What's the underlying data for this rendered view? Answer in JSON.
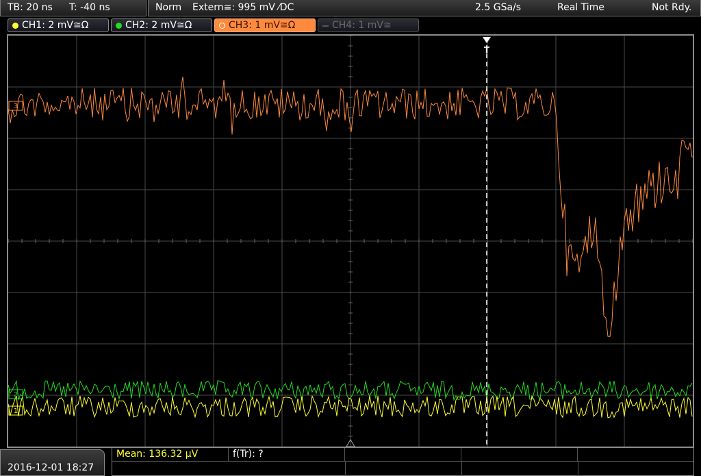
{
  "status_bar": {
    "timebase": "TB: 20 ns",
    "trigger_time": "T: -40 ns",
    "trigger_mode": "Norm",
    "trigger_source": "Extern≅: 995 mV ⁄DC",
    "sample_rate": "2.5 GSa/s",
    "acq_mode": "Real Time",
    "acq_status": "Not Rdy."
  },
  "channels": [
    {
      "label": "CH1: 2 mV≅Ω",
      "color": "#ffff33",
      "active": false,
      "enabled": true
    },
    {
      "label": "CH2: 2 mV≅Ω",
      "color": "#22dd22",
      "active": false,
      "enabled": true
    },
    {
      "label": "CH3: 1 mV≅Ω",
      "color": "#ff8a3d",
      "active": true,
      "enabled": true
    },
    {
      "label": "CH4: 1 mV≅",
      "color": "#666666",
      "active": false,
      "enabled": false
    }
  ],
  "markers": {
    "trigger_label": "T",
    "ch1_marker": "1",
    "ch2_marker": "2",
    "ch3_marker": "3"
  },
  "measurements": {
    "mean": "Mean: 136.32 µV",
    "rise_freq": "f(Tr): ?"
  },
  "datetime": "2016-12-01 18:27",
  "colors": {
    "grid": "#4a4a4a",
    "ch1": "#ffff33",
    "ch2": "#22dd22",
    "ch3": "#ff8a3d",
    "trigger_line": "#ffffff"
  }
}
